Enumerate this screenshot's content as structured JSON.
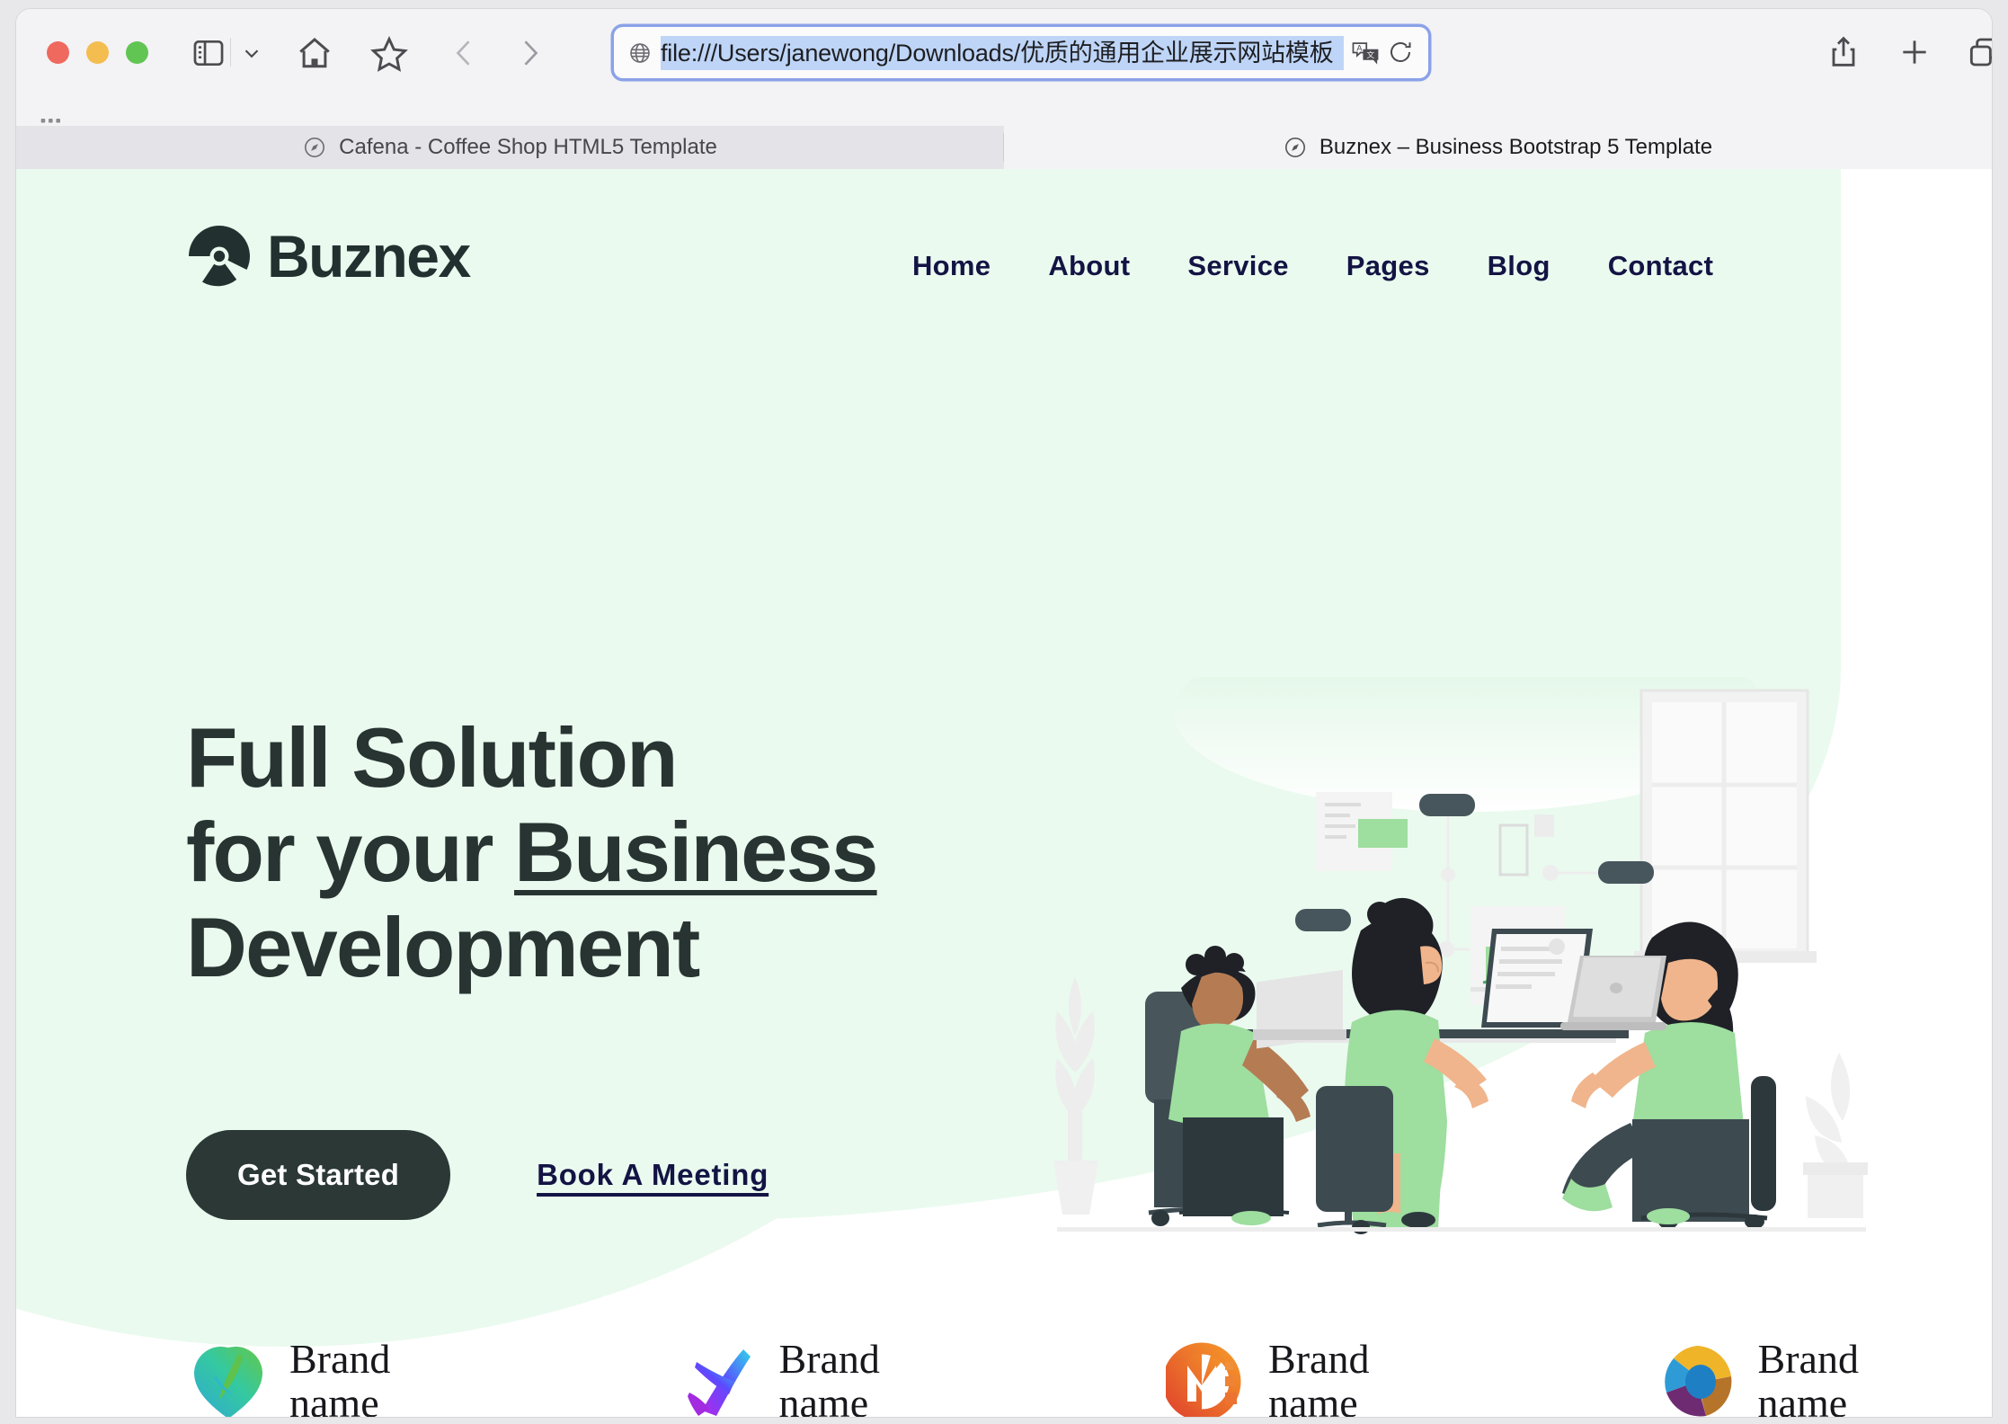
{
  "browser": {
    "url": "file:///Users/janewong/Downloads/优质的通用企业展示网站模板",
    "toolbar_icons": {
      "sidebar": "sidebar-icon",
      "sidebar_chevron": "chevron-down-icon",
      "home": "home-icon",
      "bookmark": "star-icon",
      "back": "back-chevron-icon",
      "forward": "forward-chevron-icon",
      "globe": "globe-icon",
      "translate": "translate-icon",
      "reload": "reload-icon",
      "share": "share-icon",
      "new_tab": "plus-icon",
      "tab_overview": "tab-overview-icon",
      "grid": "grid-icon"
    },
    "tabs": [
      {
        "title": "Cafena - Coffee Shop HTML5 Template",
        "active": false
      },
      {
        "title": "Buznex – Business Bootstrap 5 Template",
        "active": true
      }
    ]
  },
  "site": {
    "brand_name": "Buznex",
    "nav": [
      {
        "label": "Home"
      },
      {
        "label": "About"
      },
      {
        "label": "Service"
      },
      {
        "label": "Pages"
      },
      {
        "label": "Blog"
      },
      {
        "label": "Contact"
      }
    ],
    "hero": {
      "line1": "Full Solution",
      "line2_before": "for your ",
      "line2_underlined": "Business",
      "line3": "Development",
      "primary_cta": "Get Started",
      "secondary_cta": "Book A Meeting",
      "illustration": "team-meeting-illustration"
    },
    "brands": [
      {
        "name_line1": "Brand",
        "name_line2": "name",
        "mark": "leaf-drop-logo"
      },
      {
        "name_line1": "Brand",
        "name_line2": "name",
        "mark": "gradient-arrow-logo"
      },
      {
        "name_line1": "Brand",
        "name_line2": "name",
        "mark": "orange-m-logo"
      },
      {
        "name_line1": "Brand",
        "name_line2": "name",
        "mark": "multicolor-circle-logo"
      }
    ]
  },
  "colors": {
    "mint_bg": "#eafaef",
    "dark": "#2b3835",
    "navy": "#131444",
    "accent_green": "#9ede9f"
  }
}
